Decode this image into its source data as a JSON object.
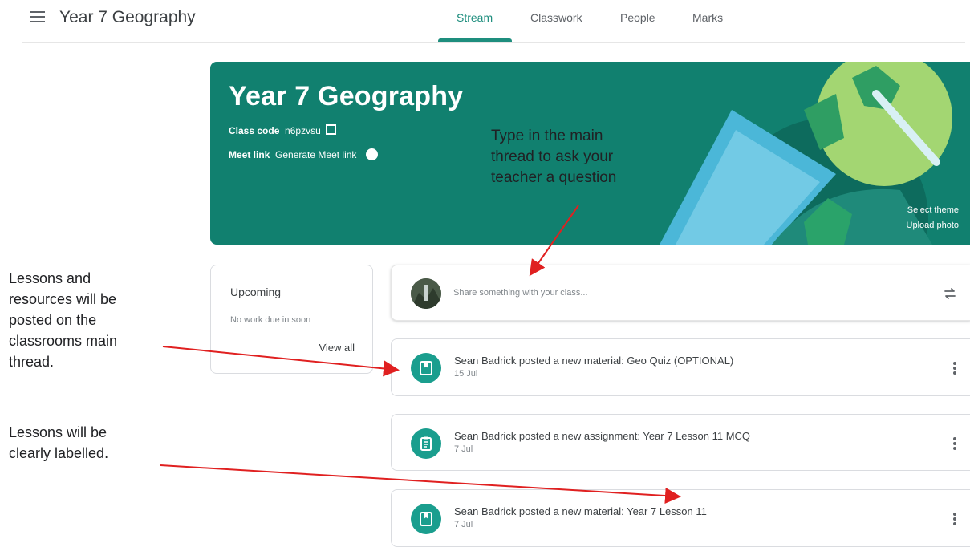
{
  "header": {
    "title": "Year 7 Geography",
    "tabs": [
      {
        "label": "Stream"
      },
      {
        "label": "Classwork"
      },
      {
        "label": "People"
      },
      {
        "label": "Marks"
      }
    ]
  },
  "banner": {
    "title": "Year 7 Geography",
    "class_code_label": "Class code",
    "class_code_value": "n6pzvsu",
    "meet_label": "Meet link",
    "meet_value": "Generate Meet link",
    "select_theme": "Select theme",
    "upload_photo": "Upload photo"
  },
  "upcoming": {
    "title": "Upcoming",
    "subtitle": "No work due in soon",
    "view_all": "View all"
  },
  "share": {
    "placeholder": "Share something with your class..."
  },
  "posts": [
    {
      "title": "Sean Badrick posted a new material: Geo Quiz (OPTIONAL)",
      "date": "15 Jul",
      "icon": "material-icon"
    },
    {
      "title": "Sean Badrick posted a new assignment: Year 7 Lesson 11 MCQ",
      "date": "7 Jul",
      "icon": "assignment-icon"
    },
    {
      "title": "Sean Badrick posted a new material: Year 7 Lesson 11",
      "date": "7 Jul",
      "icon": "material-icon"
    }
  ],
  "annotations": {
    "main_thread": [
      "Type in the main",
      "thread to ask your",
      "teacher a question"
    ],
    "lessons_posted": [
      "Lessons and",
      "resources will be",
      "posted on the",
      "classrooms main",
      "thread."
    ],
    "lessons_labelled": [
      "Lessons will be",
      "clearly labelled."
    ]
  },
  "colors": {
    "accent": "#1e8e7e",
    "banner": "#11806f",
    "post_icon": "#1a9e8e",
    "annotation_arrow": "#e02020"
  }
}
